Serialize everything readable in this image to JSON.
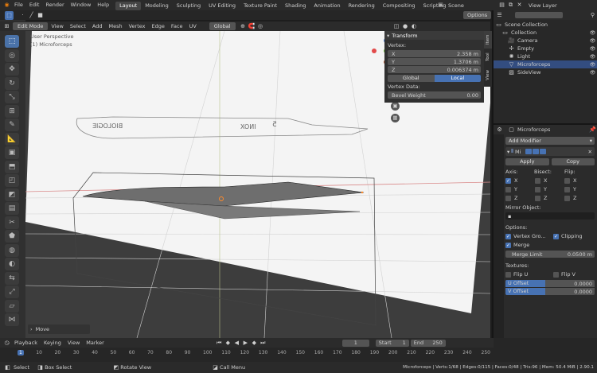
{
  "topbar": {
    "menus": [
      "File",
      "Edit",
      "Render",
      "Window",
      "Help"
    ],
    "tabs": [
      "Layout",
      "Modeling",
      "Sculpting",
      "UV Editing",
      "Texture Paint",
      "Shading",
      "Animation",
      "Rendering",
      "Compositing",
      "Scripting"
    ],
    "active_tab": "Layout",
    "scene": "Scene",
    "view_layer": "View Layer"
  },
  "viewport_header": {
    "mode": "Edit Mode",
    "menus": [
      "View",
      "Select",
      "Add",
      "Mesh",
      "Vertex",
      "Edge",
      "Face",
      "UV"
    ],
    "orientation": "Global",
    "options": "Options"
  },
  "viewport": {
    "perspective": "User Perspective",
    "object": "(1) Microforceps",
    "overlay_text_1": "BIOLOGIE",
    "overlay_text_2": "INOX",
    "overlay_text_3": "5",
    "last_op": "Move"
  },
  "n_panel": {
    "tabs": [
      "Item",
      "Tool",
      "View"
    ],
    "title": "Transform",
    "vertex_label": "Vertex:",
    "x_label": "X",
    "x_value": "2.358 m",
    "y_label": "Y",
    "y_value": "1.3706 m",
    "z_label": "Z",
    "z_value": "0.006374 m",
    "space_global": "Global",
    "space_local": "Local",
    "vertex_data": "Vertex Data:",
    "bevel_weight_label": "Bevel Weight",
    "bevel_weight_value": "0.00"
  },
  "outliner": {
    "items": [
      {
        "label": "Scene Collection",
        "icon": "collection-icon"
      },
      {
        "label": "Collection",
        "icon": "collection-icon"
      },
      {
        "label": "Camera",
        "icon": "camera-icon"
      },
      {
        "label": "Empty",
        "icon": "empty-icon"
      },
      {
        "label": "Light",
        "icon": "light-icon"
      },
      {
        "label": "Microforceps",
        "icon": "mesh-icon"
      },
      {
        "label": "SideView",
        "icon": "image-icon"
      }
    ]
  },
  "properties": {
    "object_name": "Microforceps",
    "add_modifier": "Add Modifier",
    "modifier_name": "Mi",
    "apply": "Apply",
    "copy": "Copy",
    "axis_label": "Axis:",
    "bisect_label": "Bisect:",
    "flip_label": "Flip:",
    "x": "X",
    "y": "Y",
    "z": "Z",
    "mirror_object_label": "Mirror Object:",
    "options_label": "Options:",
    "vertex_groups": "Vertex Gro...",
    "clipping": "Clipping",
    "merge": "Merge",
    "merge_limit_label": "Merge Limit",
    "merge_limit_value": "0.0500 m",
    "textures_label": "Textures:",
    "flip_u": "Flip U",
    "flip_v": "Flip V",
    "u_offset_label": "U Offset",
    "u_offset_value": "0.0000",
    "v_offset_label": "V Offset",
    "v_offset_value": "0.0000"
  },
  "timeline": {
    "menus": [
      "Playback",
      "Keying",
      "View",
      "Marker"
    ],
    "current_frame": "1",
    "start_label": "Start",
    "start_value": "1",
    "end_label": "End",
    "end_value": "250",
    "ticks": [
      "1",
      "10",
      "20",
      "30",
      "40",
      "50",
      "60",
      "70",
      "80",
      "90",
      "100",
      "110",
      "120",
      "130",
      "140",
      "150",
      "160",
      "170",
      "180",
      "190",
      "200",
      "210",
      "220",
      "230",
      "240",
      "250"
    ]
  },
  "statusbar": {
    "select": "Select",
    "box_select": "Box Select",
    "rotate_view": "Rotate View",
    "call_menu": "Call Menu",
    "info": "Microforceps | Verts:1/68 | Edges:0/115 | Faces:0/48 | Tris:96 | Mem: 50.4 MiB | 2.90.1"
  },
  "colors": {
    "accent": "#4772b3",
    "selected_row": "#334d80",
    "orange_vertex": "#ff8a2a",
    "header_bg": "#2b2b2b"
  }
}
